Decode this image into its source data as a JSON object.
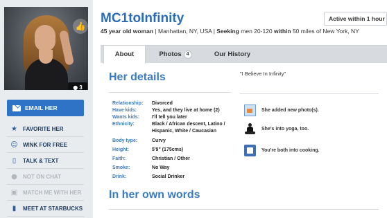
{
  "profile": {
    "username": "MC1toInfinity",
    "age_text": "45 year old woman",
    "location": "Manhattan, NY, USA",
    "seeking_label": "Seeking",
    "seeking_text": "men 20-120",
    "within_label": "within",
    "within_text": "50 miles of New York, NY",
    "active_status": "Active within 1 hour",
    "photo_count": "3"
  },
  "actions": {
    "email": "EMAIL HER",
    "favorite": "FAVORITE HER",
    "wink": "WINK FOR FREE",
    "talk": "TALK & TEXT",
    "chat": "NOT ON CHAT",
    "match": "MATCH ME WITH HER",
    "starbucks": "MEET AT STARBUCKS"
  },
  "tabs": [
    {
      "label": "About"
    },
    {
      "label": "Photos",
      "count": "4"
    },
    {
      "label": "Our History"
    }
  ],
  "details": {
    "heading": "Her details",
    "rows": [
      {
        "key": "Relationship:",
        "value": "Divorced"
      },
      {
        "key": "Have kids:",
        "value": "Yes, and they live at home (2)"
      },
      {
        "key": "Wants kids:",
        "value": "I'll tell you later"
      },
      {
        "key": "Ethnicity:",
        "value": "Black / African descent, Latino / Hispanic, White / Caucasian"
      },
      {
        "key": "Body type:",
        "value": "Curvy"
      },
      {
        "key": "Height:",
        "value": "5'9\" (175cms)"
      },
      {
        "key": "Faith:",
        "value": "Christian / Other"
      },
      {
        "key": "Smoke:",
        "value": "No Way"
      },
      {
        "key": "Drink:",
        "value": "Social Drinker"
      }
    ]
  },
  "tagline": "\"I Believe In Infinity\"",
  "matches": [
    {
      "icon": "photo-icon",
      "text": "She added new photo(s)."
    },
    {
      "icon": "yoga-icon",
      "text": "She's into yoga, too."
    },
    {
      "icon": "cooking-icon",
      "text": "You're both into cooking."
    }
  ],
  "own_words_heading": "In her own words",
  "colors": {
    "link_blue": "#2b6cb6",
    "button_blue": "#2e73c6",
    "sidebar_bg": "#e9ecef",
    "tabbar_bg": "#d7dbe0"
  }
}
